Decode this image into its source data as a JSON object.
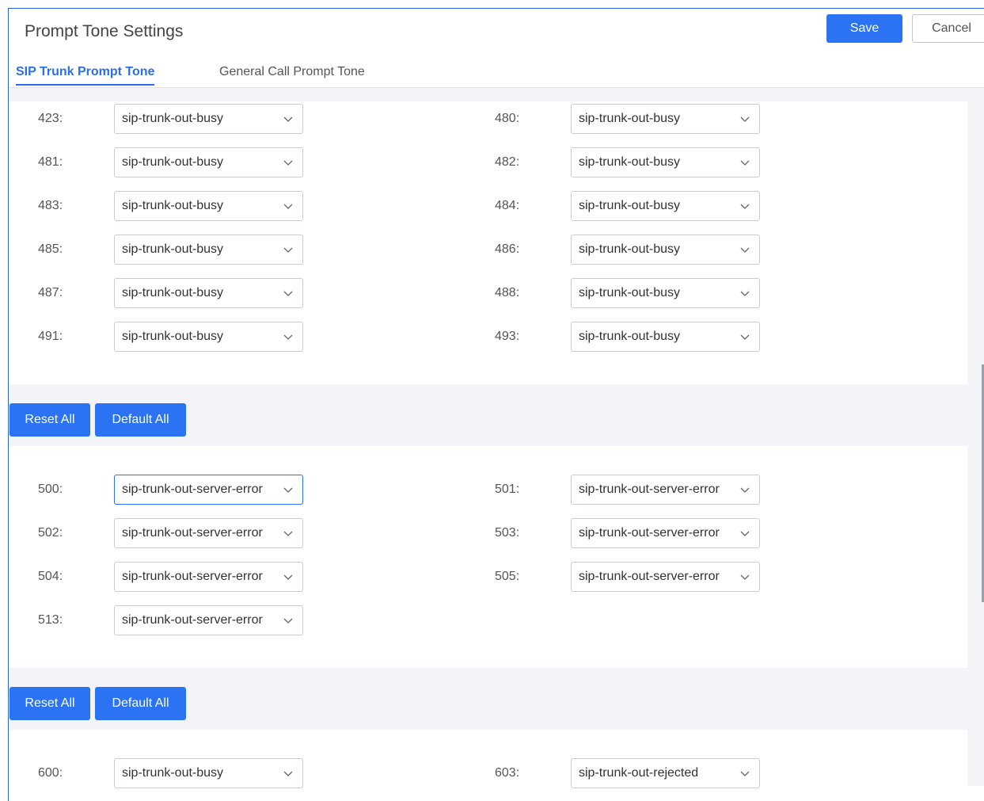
{
  "header": {
    "title": "Prompt Tone Settings",
    "save_label": "Save",
    "cancel_label": "Cancel"
  },
  "tabs": [
    {
      "label": "SIP Trunk Prompt Tone",
      "active": true
    },
    {
      "label": "General Call Prompt Tone",
      "active": false
    }
  ],
  "section_4xx": {
    "rows": [
      {
        "left": {
          "label": "423:",
          "value": "sip-trunk-out-busy"
        },
        "right": {
          "label": "480:",
          "value": "sip-trunk-out-busy"
        }
      },
      {
        "left": {
          "label": "481:",
          "value": "sip-trunk-out-busy"
        },
        "right": {
          "label": "482:",
          "value": "sip-trunk-out-busy"
        }
      },
      {
        "left": {
          "label": "483:",
          "value": "sip-trunk-out-busy"
        },
        "right": {
          "label": "484:",
          "value": "sip-trunk-out-busy"
        }
      },
      {
        "left": {
          "label": "485:",
          "value": "sip-trunk-out-busy"
        },
        "right": {
          "label": "486:",
          "value": "sip-trunk-out-busy"
        }
      },
      {
        "left": {
          "label": "487:",
          "value": "sip-trunk-out-busy"
        },
        "right": {
          "label": "488:",
          "value": "sip-trunk-out-busy"
        }
      },
      {
        "left": {
          "label": "491:",
          "value": "sip-trunk-out-busy"
        },
        "right": {
          "label": "493:",
          "value": "sip-trunk-out-busy"
        }
      }
    ],
    "reset_label": "Reset All",
    "default_label": "Default All"
  },
  "section_5xx": {
    "rows": [
      {
        "left": {
          "label": "500:",
          "value": "sip-trunk-out-server-error"
        },
        "right": {
          "label": "501:",
          "value": "sip-trunk-out-server-error"
        }
      },
      {
        "left": {
          "label": "502:",
          "value": "sip-trunk-out-server-error"
        },
        "right": {
          "label": "503:",
          "value": "sip-trunk-out-server-error"
        }
      },
      {
        "left": {
          "label": "504:",
          "value": "sip-trunk-out-server-error"
        },
        "right": {
          "label": "505:",
          "value": "sip-trunk-out-server-error"
        }
      },
      {
        "left": {
          "label": "513:",
          "value": "sip-trunk-out-server-error"
        }
      }
    ],
    "reset_label": "Reset All",
    "default_label": "Default All"
  },
  "section_6xx": {
    "rows": [
      {
        "left": {
          "label": "600:",
          "value": "sip-trunk-out-busy"
        },
        "right": {
          "label": "603:",
          "value": "sip-trunk-out-rejected"
        }
      }
    ]
  },
  "colors": {
    "accent": "#2b73f2",
    "tab_active": "#2b6fe8",
    "frame_border": "#2a66d9"
  },
  "icons": {
    "select_arrow": "chevron-down-icon"
  }
}
